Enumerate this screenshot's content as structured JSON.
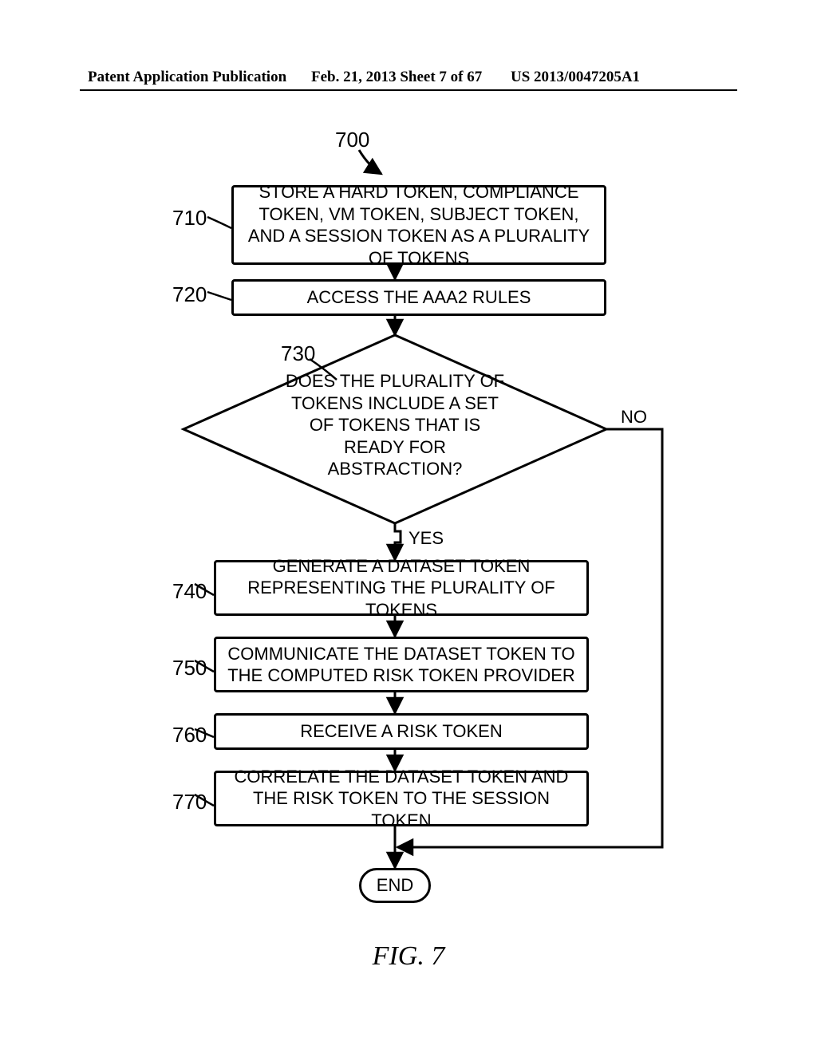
{
  "header": {
    "left": "Patent Application Publication",
    "mid": "Feb. 21, 2013  Sheet 7 of 67",
    "right": "US 2013/0047205A1"
  },
  "figure": {
    "number": "700",
    "caption": "FIG. 7",
    "refs": {
      "r710": "710",
      "r720": "720",
      "r730": "730",
      "r740": "740",
      "r750": "750",
      "r760": "760",
      "r770": "770"
    },
    "steps": {
      "s710": "STORE A HARD TOKEN, COMPLIANCE TOKEN, VM TOKEN, SUBJECT TOKEN, AND A SESSION TOKEN AS A PLURALITY OF TOKENS",
      "s720": "ACCESS THE AAA2 RULES",
      "s730": "DOES THE PLURALITY OF TOKENS INCLUDE A SET OF TOKENS THAT IS READY FOR ABSTRACTION?",
      "s740": "GENERATE A DATASET TOKEN REPRESENTING THE PLURALITY OF TOKENS",
      "s750": "COMMUNICATE THE DATASET TOKEN TO THE COMPUTED RISK TOKEN PROVIDER",
      "s760": "RECEIVE A RISK TOKEN",
      "s770": "CORRELATE THE DATASET TOKEN AND THE RISK TOKEN TO THE SESSION TOKEN",
      "end": "END"
    },
    "branches": {
      "yes": "YES",
      "no": "NO"
    }
  }
}
